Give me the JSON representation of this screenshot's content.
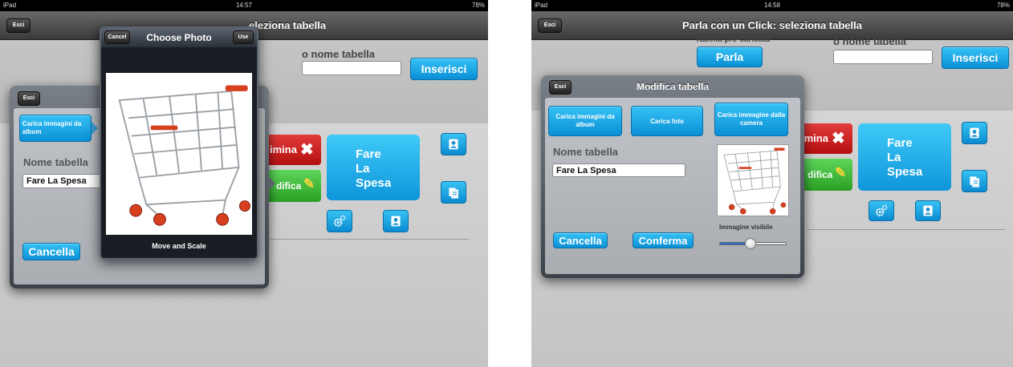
{
  "left_screen": {
    "status": {
      "device": "iPad",
      "time": "14:57",
      "battery": "78%"
    },
    "nav": {
      "esci": "Esci",
      "title_partial": "eleziona tabella"
    },
    "name_label": "o nome tabella",
    "insert_label": "Inserisci",
    "delete_partial": "imina",
    "edit_partial": "difica",
    "tile_text": [
      "Fare",
      "La",
      "Spesa"
    ],
    "popover": {
      "esci": "Esci",
      "load_album": "Carica immagini da album",
      "name_label": "Nome tabella",
      "name_value": "Fare La Spesa",
      "cancel": "Cancella"
    },
    "chooser": {
      "cancel": "Cancel",
      "title": "Choose Photo",
      "use": "Use",
      "footer": "Move and Scale"
    }
  },
  "right_screen": {
    "status": {
      "device": "iPad",
      "time": "14:58",
      "battery": "78%"
    },
    "nav": {
      "esci": "Esci",
      "title": "Parla con un Click: seleziona tabella"
    },
    "preloaded_label": "Tabella pre-caricata",
    "speak_label": "Parla",
    "name_label": "o nome tabella",
    "insert_label": "Inserisci",
    "delete_partial": "imina",
    "edit_partial": "difica",
    "tile_text": [
      "Fare",
      "La",
      "Spesa"
    ],
    "popover": {
      "esci": "Esci",
      "title": "Modifica tabella",
      "load_album": "Carica immagini da album",
      "load_photo": "Carica foto",
      "load_camera": "Carica immagine dalla camera",
      "name_label": "Nome tabella",
      "name_value": "Fare La Spesa",
      "cancel": "Cancella",
      "confirm": "Conferma",
      "visible_label": "Immagine visibile",
      "visible_level": 0.45
    }
  },
  "colors": {
    "accent_blue": "#1aa3e8",
    "danger_red": "#d42020",
    "success_green": "#3cbf36",
    "nav_dark": "#3a3a3a"
  }
}
